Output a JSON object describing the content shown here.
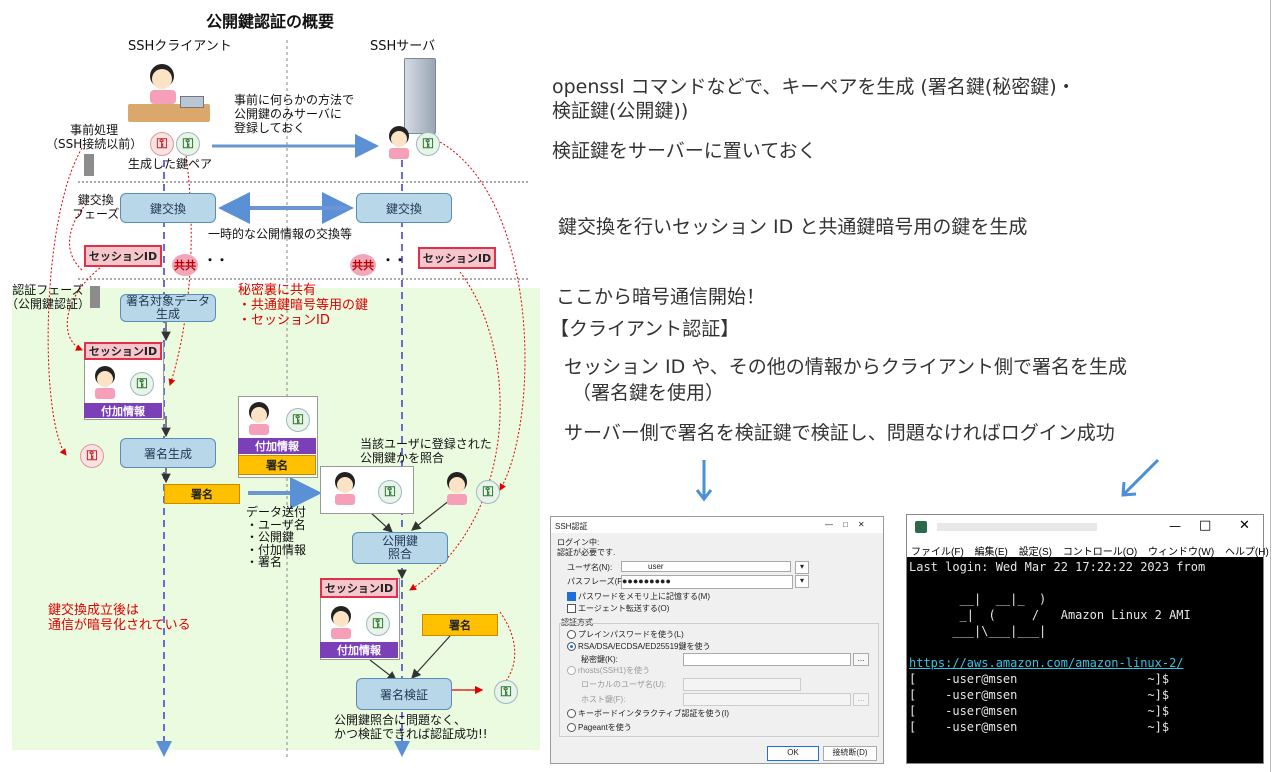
{
  "diagram": {
    "title": "公開鍵認証の概要",
    "client_label": "SSHクライアント",
    "server_label": "SSHサーバ",
    "pre_process": "事前処理\n（SSH接続以前）",
    "pre_register_note": "事前に何らかの方法で\n公開鍵のみサーバに\n登録しておく",
    "generated_pair": "生成した鍵ペア",
    "kex_phase": "鍵交換\nフェーズ",
    "kex_box": "鍵交換",
    "temp_exchange": "一時的な公開情報の交換等",
    "session_id": "セッションID",
    "kyo": "共共",
    "dots": "・・",
    "auth_phase": "認証フェーズ\n（公開鍵認証）",
    "sign_target": "署名対象データ\n生成",
    "secret_share": "秘密裏に共有\n・共通鍵暗号等用の鍵\n・セッションID",
    "addl_info": "付加情報",
    "sig": "署名",
    "sig_gen": "署名生成",
    "lookup_note": "当該ユーザに登録された\n公開鍵かを照合",
    "data_send": "データ送付\n・ユーザ名\n・公開鍵\n・付加情報\n・署名",
    "pubkey_match": "公開鍵\n照合",
    "encrypted_note": "鍵交換成立後は\n通信が暗号化されている",
    "sig_verify": "署名検証",
    "success_note": "公開鍵照合に問題なく、\nかつ検証できれば認証成功!!"
  },
  "notes": {
    "line1a": "openssl コマンドなどで、キーペアを生成 (署名鍵(秘密鍵)・",
    "line1b": "検証鍵(公開鍵))",
    "line2": "検証鍵をサーバーに置いておく",
    "line3": "鍵交換を行いセッション ID と共通鍵暗号用の鍵を生成",
    "line4": "ここから暗号通信開始！",
    "line5": "【クライアント認証】",
    "line6a": "セッション ID や、その他の情報からクライアント側で署名を生成",
    "line6b": "（署名鍵を使用）",
    "line7": "サーバー側で署名を検証鍵で検証し、問題なければログイン成功"
  },
  "ssh_dialog": {
    "title": "SSH認証",
    "login_label": "ログイン中:",
    "auth_required": "認証が必要です.",
    "username_label": "ユーザ名(N):",
    "username_value": "user",
    "passphrase_label": "パスフレーズ(P):",
    "passphrase_value": "●●●●●●●●●",
    "remember_pw": "パスワードをメモリ上に記憶する(M)",
    "agent_forward": "エージェント転送する(O)",
    "auth_method": "認証方式",
    "plain_password": "プレインパスワードを使う(L)",
    "rsa_key": "RSA/DSA/ECDSA/ED25519鍵を使う",
    "private_key": "秘密鍵(K):",
    "rhosts": "rhosts(SSH1)を使う",
    "local_user": "ローカルのユーザ名(U):",
    "host_key": "ホスト鍵(F):",
    "keyboard_interactive": "キーボードインタラクティブ認証を使う(I)",
    "pageant": "Pageantを使う",
    "ok": "OK",
    "disconnect": "接続断(D)",
    "browse": "..."
  },
  "terminal": {
    "menu": [
      "ファイル(F)",
      "編集(E)",
      "設定(S)",
      "コントロール(O)",
      "ウィンドウ(W)",
      "ヘルプ(H)"
    ],
    "lines": [
      "Last login: Wed Mar 22 17:22:22 2023 from",
      "",
      "       __|  __|_  )",
      "       _|  (     /   Amazon Linux 2 AMI",
      "      ___|\\___|___|",
      "",
      "https://aws.amazon.com/amazon-linux-2/",
      "[    -user@msen                  ~]$",
      "[    -user@msen                  ~]$",
      "[    -user@msen                  ~]$",
      "[    -user@msen                  ~]$"
    ]
  },
  "colors": {
    "green_bg": "#eafbe0",
    "process": "#b8d7e8",
    "session_red": "#e0304a",
    "purple": "#7b3fb8",
    "yellow": "#ffc000",
    "arrow_blue": "#5b8fd6"
  }
}
